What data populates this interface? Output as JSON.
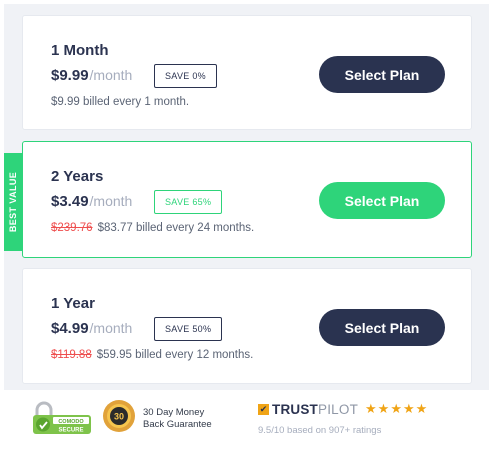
{
  "plans": [
    {
      "name": "1 Month",
      "price": "$9.99",
      "per": "/month",
      "save": "SAVE 0%",
      "old_price": "",
      "billed": "$9.99 billed every 1 month.",
      "button": "Select Plan"
    },
    {
      "name": "2 Years",
      "price": "$3.49",
      "per": "/month",
      "save": "SAVE 65%",
      "old_price": "$239.76",
      "billed": "$83.77 billed every 24 months.",
      "button": "Select Plan"
    },
    {
      "name": "1 Year",
      "price": "$4.99",
      "per": "/month",
      "save": "SAVE 50%",
      "old_price": "$119.88",
      "billed": "$59.95 billed every 12 months.",
      "button": "Select Plan"
    }
  ],
  "ribbon": "BEST VALUE",
  "footer": {
    "comodo_top": "COMODO",
    "comodo_bottom": "SECURE",
    "seal_number": "30",
    "guarantee_line1": "30 Day Money",
    "guarantee_line2": "Back Guarantee",
    "trustpilot_part1": "TRUST",
    "trustpilot_part2": "PILOT",
    "stars": "★★★★★",
    "rating": "9.5/10 based on 907+ ratings"
  },
  "colors": {
    "navy": "#2a3350",
    "green": "#2ed47a",
    "red": "#ee4e4e",
    "star": "#f0a416"
  }
}
